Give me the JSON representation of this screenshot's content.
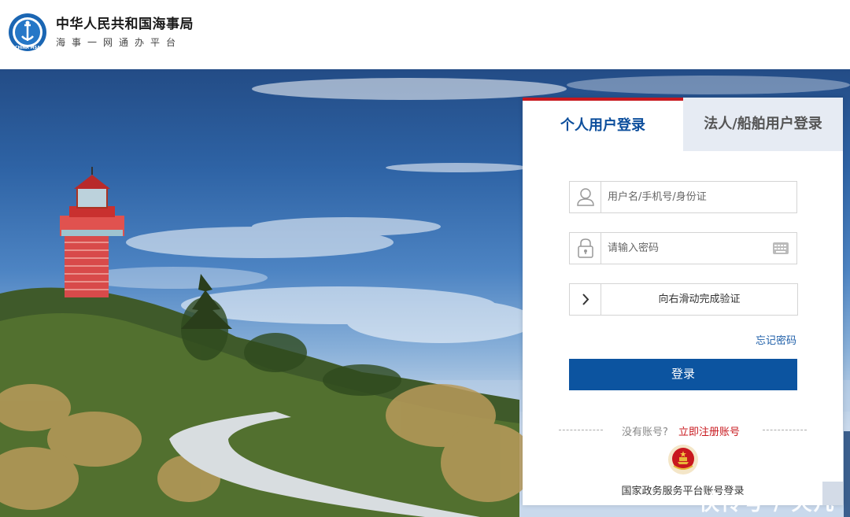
{
  "header": {
    "org_name": "中华人民共和国海事局",
    "subtitle": "海事一网通办平台",
    "logo_text": "CHINA MSA"
  },
  "login": {
    "tabs": {
      "personal": "个人用户登录",
      "corporate": "法人/船舶用户登录"
    },
    "active_tab": "personal",
    "username_placeholder": "用户名/手机号/身份证",
    "password_placeholder": "请输入密码",
    "slider_text": "向右滑动完成验证",
    "forgot_password": "忘记密码",
    "submit_label": "登录",
    "no_account": "没有账号?",
    "register_link": "立即注册账号",
    "gov_login": "国家政务服务平台账号登录"
  },
  "watermark": "快传号 / 天凡",
  "colors": {
    "brand_blue": "#0c54a0",
    "accent_red": "#c8181e",
    "tab_inactive_bg": "#e6ebf3"
  },
  "icons": {
    "username": "user-icon",
    "password": "lock-icon",
    "keyboard": "keyboard-icon",
    "slider": "chevron-right-icon",
    "emblem": "national-emblem-icon"
  }
}
